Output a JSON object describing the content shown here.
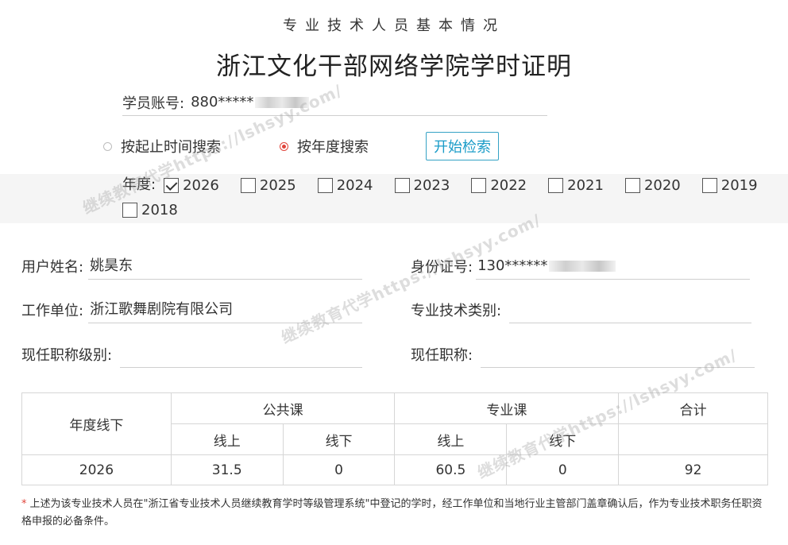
{
  "header": {
    "subtitle": "专业技术人员基本情况",
    "title": "浙江文化干部网络学院学时证明"
  },
  "account": {
    "label": "学员账号:",
    "value": "880*****"
  },
  "search": {
    "option_range": "按起止时间搜索",
    "option_year": "按年度搜索",
    "button": "开始检索"
  },
  "years": {
    "label": "年度:",
    "items": [
      {
        "year": "2026",
        "checked": true
      },
      {
        "year": "2025",
        "checked": false
      },
      {
        "year": "2024",
        "checked": false
      },
      {
        "year": "2023",
        "checked": false
      },
      {
        "year": "2022",
        "checked": false
      },
      {
        "year": "2021",
        "checked": false
      },
      {
        "year": "2020",
        "checked": false
      },
      {
        "year": "2019",
        "checked": false
      },
      {
        "year": "2018",
        "checked": false
      }
    ]
  },
  "info": {
    "name_label": "用户姓名:",
    "name_value": "姚昊东",
    "id_label": "身份证号:",
    "id_value": "130******",
    "unit_label": "工作单位:",
    "unit_value": "浙江歌舞剧院有限公司",
    "category_label": "专业技术类别:",
    "category_value": "",
    "level_label": "现任职称级别:",
    "level_value": "",
    "title_label": "现任职称:",
    "title_value": ""
  },
  "table": {
    "col_year": "年度线下",
    "col_public": "公共课",
    "col_professional": "专业课",
    "col_total": "合计",
    "sub_online": "线上",
    "sub_offline": "线下",
    "row": {
      "year": "2026",
      "public_online": "31.5",
      "public_offline": "0",
      "pro_online": "60.5",
      "pro_offline": "0",
      "total": "92"
    }
  },
  "footnote": {
    "star": "*",
    "text": "上述为该专业技术人员在\"浙江省专业技术人员继续教育学时等级管理系统\"中登记的学时，经工作单位和当地行业主管部门盖章确认后，作为专业技术职务任职资格申报的必备条件。"
  },
  "watermark": {
    "text": "继续教育代学https://lshsyy.com/"
  },
  "colors": {
    "accent": "#1a9cc8",
    "radio_checked": "#e0443a",
    "band": "#f5f5f5"
  }
}
